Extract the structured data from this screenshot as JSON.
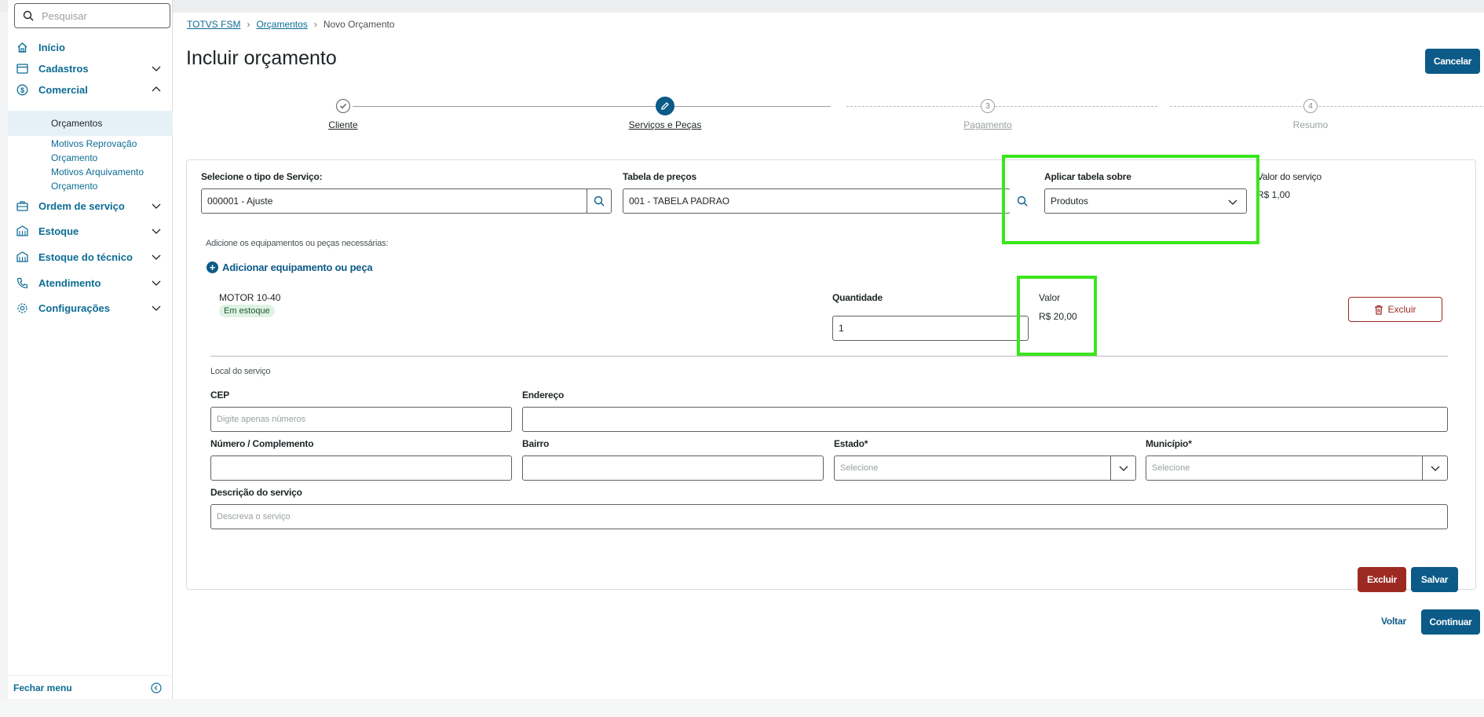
{
  "colors": {
    "primary": "#0c5a88",
    "link": "#0c6c94",
    "danger": "#9c2a23",
    "highlight": "#39e61c",
    "badge_bg": "#dff3e4"
  },
  "sidebar": {
    "search_placeholder": "Pesquisar",
    "items": [
      {
        "label": "Início",
        "icon": "home-icon"
      },
      {
        "label": "Cadastros",
        "icon": "card-icon"
      },
      {
        "label": "Comercial",
        "icon": "dollar-circle-icon"
      },
      {
        "label": "Ordem de serviço",
        "icon": "briefcase-icon"
      },
      {
        "label": "Estoque",
        "icon": "warehouse-icon"
      },
      {
        "label": "Estoque do técnico",
        "icon": "warehouse-icon"
      },
      {
        "label": "Atendimento",
        "icon": "phone-icon"
      },
      {
        "label": "Configurações",
        "icon": "gear-icon"
      }
    ],
    "sub_items": [
      {
        "label": "Orçamentos"
      },
      {
        "label": "Motivos Reprovação Orçamento"
      },
      {
        "label": "Motivos Arquivamento Orçamento"
      }
    ],
    "footer_label": "Fechar menu"
  },
  "breadcrumb": {
    "root": "TOTVS FSM",
    "parent": "Orçamentos",
    "current": "Novo Orçamento"
  },
  "page": {
    "title": "Incluir orçamento",
    "cancel_label": "Cancelar"
  },
  "stepper": {
    "steps": [
      {
        "label": "Cliente",
        "number": "",
        "state": "done"
      },
      {
        "label": "Serviços e Peças",
        "number": "",
        "state": "current"
      },
      {
        "label": "Pagamento",
        "number": "3",
        "state": "pending"
      },
      {
        "label": "Resumo",
        "number": "4",
        "state": "pending"
      }
    ]
  },
  "form": {
    "service_type_label": "Selecione o tipo de Serviço:",
    "service_type_value": "000001 - Ajuste",
    "price_table_label": "Tabela de preços",
    "price_table_value": "001 - TABELA PADRAO",
    "apply_table_label": "Aplicar tabela sobre",
    "apply_table_value": "Produtos",
    "service_value_label": "Valor do serviço",
    "service_value": "R$ 1,00",
    "equipment_hint": "Adicione os equipamentos ou peças necessárias:",
    "add_equipment_label": "Adicionar equipamento ou peça",
    "item": {
      "name": "MOTOR 10-40",
      "badge": "Em estoque",
      "quantity_label": "Quantidade",
      "quantity_value": "1",
      "value_label": "Valor",
      "value": "R$ 20,00",
      "delete_label": "Excluir"
    },
    "location_title": "Local do serviço",
    "cep_label": "CEP",
    "cep_placeholder": "Digite apenas números",
    "address_label": "Endereço",
    "number_label": "Número / Complemento",
    "district_label": "Bairro",
    "state_label": "Estado*",
    "state_placeholder": "Selecione",
    "city_label": "Município*",
    "city_placeholder": "Selecione",
    "description_label": "Descrição do serviço",
    "description_placeholder": "Descreva o serviço",
    "delete_button": "Excluir",
    "save_button": "Salvar"
  },
  "footer_actions": {
    "back_label": "Voltar",
    "continue_label": "Continuar"
  }
}
